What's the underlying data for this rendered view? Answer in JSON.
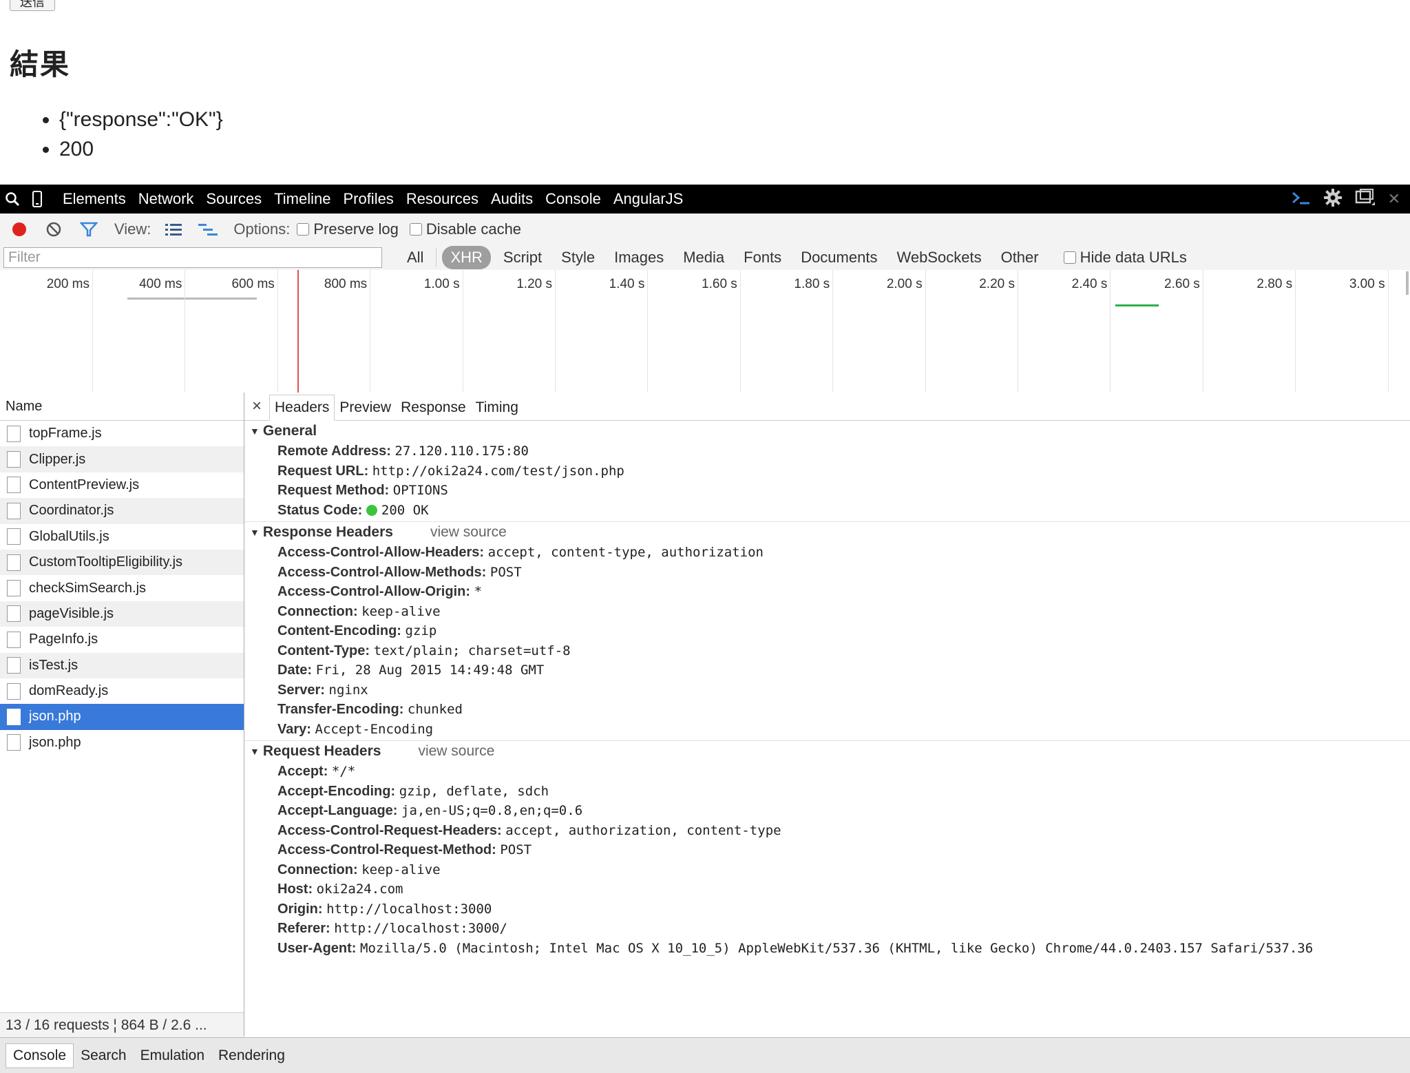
{
  "page": {
    "send_button": "送信",
    "heading": "結果",
    "results": [
      "{\"response\":\"OK\"}",
      "200"
    ]
  },
  "toolbar": {
    "tabs": [
      "Elements",
      "Network",
      "Sources",
      "Timeline",
      "Profiles",
      "Resources",
      "Audits",
      "Console",
      "AngularJS"
    ]
  },
  "controls": {
    "view_label": "View:",
    "options_label": "Options:",
    "preserve_log": "Preserve log",
    "disable_cache": "Disable cache"
  },
  "filter": {
    "placeholder": "Filter",
    "types": [
      "All",
      "XHR",
      "Script",
      "Style",
      "Images",
      "Media",
      "Fonts",
      "Documents",
      "WebSockets",
      "Other"
    ],
    "active_type": "XHR",
    "hide_data_urls": "Hide data URLs"
  },
  "timeline": {
    "ticks": [
      "200 ms",
      "400 ms",
      "600 ms",
      "800 ms",
      "1.00 s",
      "1.20 s",
      "1.40 s",
      "1.60 s",
      "1.80 s",
      "2.00 s",
      "2.20 s",
      "2.40 s",
      "2.60 s",
      "2.80 s",
      "3.00 s"
    ]
  },
  "namelist": {
    "header": "Name",
    "items": [
      "topFrame.js",
      "Clipper.js",
      "ContentPreview.js",
      "Coordinator.js",
      "GlobalUtils.js",
      "CustomTooltipEligibility.js",
      "checkSimSearch.js",
      "pageVisible.js",
      "PageInfo.js",
      "isTest.js",
      "domReady.js",
      "json.php",
      "json.php"
    ],
    "selected_index": 11
  },
  "statusbar": {
    "text": "13 / 16 requests ¦ 864 B / 2.6 ..."
  },
  "detail": {
    "close": "×",
    "tabs": [
      "Headers",
      "Preview",
      "Response",
      "Timing"
    ],
    "general": {
      "title": "General",
      "rows": [
        {
          "k": "Remote Address:",
          "v": "27.120.110.175:80"
        },
        {
          "k": "Request URL:",
          "v": "http://oki2a24.com/test/json.php"
        },
        {
          "k": "Request Method:",
          "v": "OPTIONS"
        },
        {
          "k": "Status Code:",
          "v": "200 OK"
        }
      ]
    },
    "response_headers": {
      "title": "Response Headers",
      "view_source": "view source",
      "rows": [
        {
          "k": "Access-Control-Allow-Headers:",
          "v": "accept, content-type, authorization"
        },
        {
          "k": "Access-Control-Allow-Methods:",
          "v": "POST"
        },
        {
          "k": "Access-Control-Allow-Origin:",
          "v": "*"
        },
        {
          "k": "Connection:",
          "v": "keep-alive"
        },
        {
          "k": "Content-Encoding:",
          "v": "gzip"
        },
        {
          "k": "Content-Type:",
          "v": "text/plain; charset=utf-8"
        },
        {
          "k": "Date:",
          "v": "Fri, 28 Aug 2015 14:49:48 GMT"
        },
        {
          "k": "Server:",
          "v": "nginx"
        },
        {
          "k": "Transfer-Encoding:",
          "v": "chunked"
        },
        {
          "k": "Vary:",
          "v": "Accept-Encoding"
        }
      ]
    },
    "request_headers": {
      "title": "Request Headers",
      "view_source": "view source",
      "rows": [
        {
          "k": "Accept:",
          "v": "*/*"
        },
        {
          "k": "Accept-Encoding:",
          "v": "gzip, deflate, sdch"
        },
        {
          "k": "Accept-Language:",
          "v": "ja,en-US;q=0.8,en;q=0.6"
        },
        {
          "k": "Access-Control-Request-Headers:",
          "v": "accept, authorization, content-type"
        },
        {
          "k": "Access-Control-Request-Method:",
          "v": "POST"
        },
        {
          "k": "Connection:",
          "v": "keep-alive"
        },
        {
          "k": "Host:",
          "v": "oki2a24.com"
        },
        {
          "k": "Origin:",
          "v": "http://localhost:3000"
        },
        {
          "k": "Referer:",
          "v": "http://localhost:3000/"
        },
        {
          "k": "User-Agent:",
          "v": "Mozilla/5.0 (Macintosh; Intel Mac OS X 10_10_5) AppleWebKit/537.36 (KHTML, like Gecko) Chrome/44.0.2403.157 Safari/537.36"
        }
      ]
    }
  },
  "drawer": {
    "tabs": [
      "Console",
      "Search",
      "Emulation",
      "Rendering"
    ]
  },
  "colors": {
    "selected_row": "#3879d9",
    "record_red": "#e0221f",
    "filter_blue": "#3a86d6",
    "status_green": "#3cc43c"
  }
}
